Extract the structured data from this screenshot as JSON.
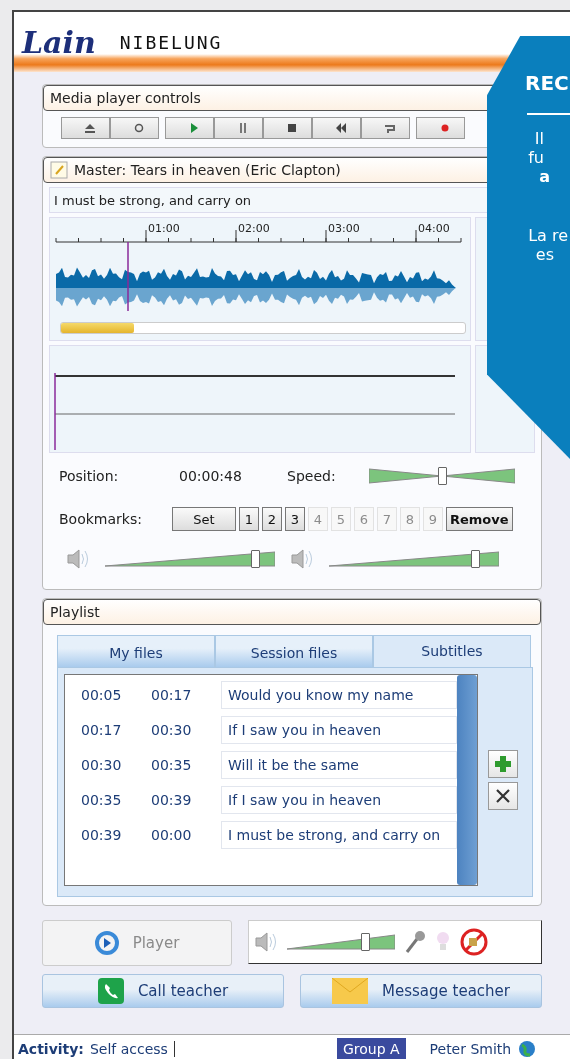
{
  "brand": {
    "logo": "Lain",
    "product": "NIBELUNG"
  },
  "media_controls": {
    "title": "Media player controls"
  },
  "master": {
    "title": "Master: Tears in heaven (Eric Clapton)",
    "current_line": "I must be strong, and carry on",
    "ticks": [
      "01:00",
      "02:00",
      "03:00",
      "04:00"
    ],
    "progress": {
      "level": 0.18
    },
    "position_label": "Position:",
    "position": "00:00:48",
    "speed_label": "Speed:",
    "speed": {
      "level": 0.5
    },
    "bookmarks_label": "Bookmarks:",
    "set_button": "Set",
    "bookmarks": [
      {
        "label": "1",
        "disabled": false
      },
      {
        "label": "2",
        "disabled": false
      },
      {
        "label": "3",
        "disabled": false
      },
      {
        "label": "4",
        "disabled": true
      },
      {
        "label": "5",
        "disabled": true
      },
      {
        "label": "6",
        "disabled": true
      },
      {
        "label": "7",
        "disabled": true
      },
      {
        "label": "8",
        "disabled": true
      },
      {
        "label": "9",
        "disabled": true
      }
    ],
    "remove_button": "Remove",
    "volumes": [
      {
        "level": 0.88
      },
      {
        "level": 0.86
      }
    ]
  },
  "playlist": {
    "title": "Playlist",
    "tabs": [
      {
        "label": "My files",
        "selected": false
      },
      {
        "label": "Session files",
        "selected": false
      },
      {
        "label": "Subtitles",
        "selected": true
      }
    ],
    "rows": [
      {
        "start": "00:05",
        "end": "00:17",
        "text": "Would you know my name"
      },
      {
        "start": "00:17",
        "end": "00:30",
        "text": "If I saw you in heaven"
      },
      {
        "start": "00:30",
        "end": "00:35",
        "text": "Will it be the same"
      },
      {
        "start": "00:35",
        "end": "00:39",
        "text": "If I saw you in heaven"
      },
      {
        "start": "00:39",
        "end": "00:00",
        "text": "I must be strong, and carry on"
      }
    ]
  },
  "player_button": {
    "label": "Player",
    "disabled": true
  },
  "audio": {
    "volume": {
      "level": 0.72
    }
  },
  "actions": [
    "Call teacher",
    "Message teacher"
  ],
  "status_bar": {
    "activity_label": "Activity:",
    "activity": "Self access",
    "group": "Group A",
    "user": "Peter Smith"
  },
  "callout": {
    "title": "REC",
    "lines": [
      {
        "text": "Il",
        "bold": false
      },
      {
        "text": "fu",
        "bold": false
      },
      {
        "text": "a",
        "bold": true
      },
      {
        "text": "La re",
        "bold": false
      },
      {
        "text": "es",
        "bold": false
      }
    ]
  }
}
